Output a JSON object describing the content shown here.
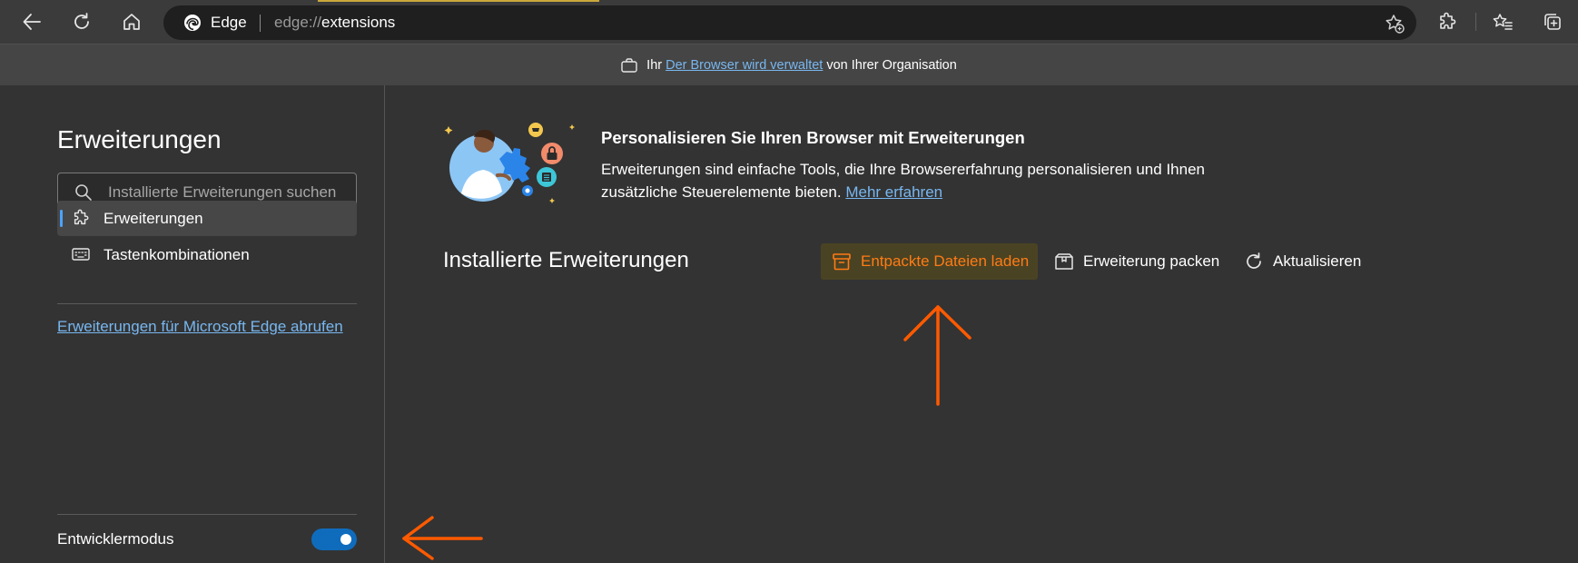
{
  "toolbar": {
    "back_icon": "arrow-left-icon",
    "refresh_icon": "refresh-icon",
    "home_icon": "home-icon",
    "address": {
      "browser_name": "Edge",
      "url_scheme": "edge://",
      "url_host": "extensions"
    },
    "favorites_add_icon": "star-add-icon",
    "extensions_icon": "puzzle-icon",
    "favorites_icon": "favorites-list-icon",
    "collections_icon": "collections-icon"
  },
  "managed_banner": {
    "prefix": "Ihr",
    "link": "Der Browser wird verwaltet",
    "suffix": "von Ihrer Organisation"
  },
  "sidebar": {
    "title": "Erweiterungen",
    "search_placeholder": "Installierte Erweiterungen suchen",
    "items": [
      {
        "label": "Erweiterungen",
        "icon": "puzzle-icon",
        "active": true
      },
      {
        "label": "Tastenkombinationen",
        "icon": "keyboard-icon",
        "active": false
      }
    ],
    "store_link": "Erweiterungen für Microsoft Edge abrufen",
    "developer_mode": {
      "label": "Entwicklermodus",
      "enabled": true
    }
  },
  "main": {
    "hero": {
      "title": "Personalisieren Sie Ihren Browser mit Erweiterungen",
      "description": "Erweiterungen sind einfache Tools, die Ihre Browsererfahrung personalisieren und Ihnen zusätzliche Steuerelemente bieten.",
      "learn_more": "Mehr erfahren"
    },
    "installed_title": "Installierte Erweiterungen",
    "actions": {
      "load_unpacked": "Entpackte Dateien laden",
      "pack_extension": "Erweiterung packen",
      "update": "Aktualisieren"
    }
  },
  "colors": {
    "background": "#333333",
    "accent_blue": "#0f6cbd",
    "link_blue": "#78b7f0",
    "annotation_orange": "#ff5a00",
    "highlight_text": "#ff7b15"
  }
}
